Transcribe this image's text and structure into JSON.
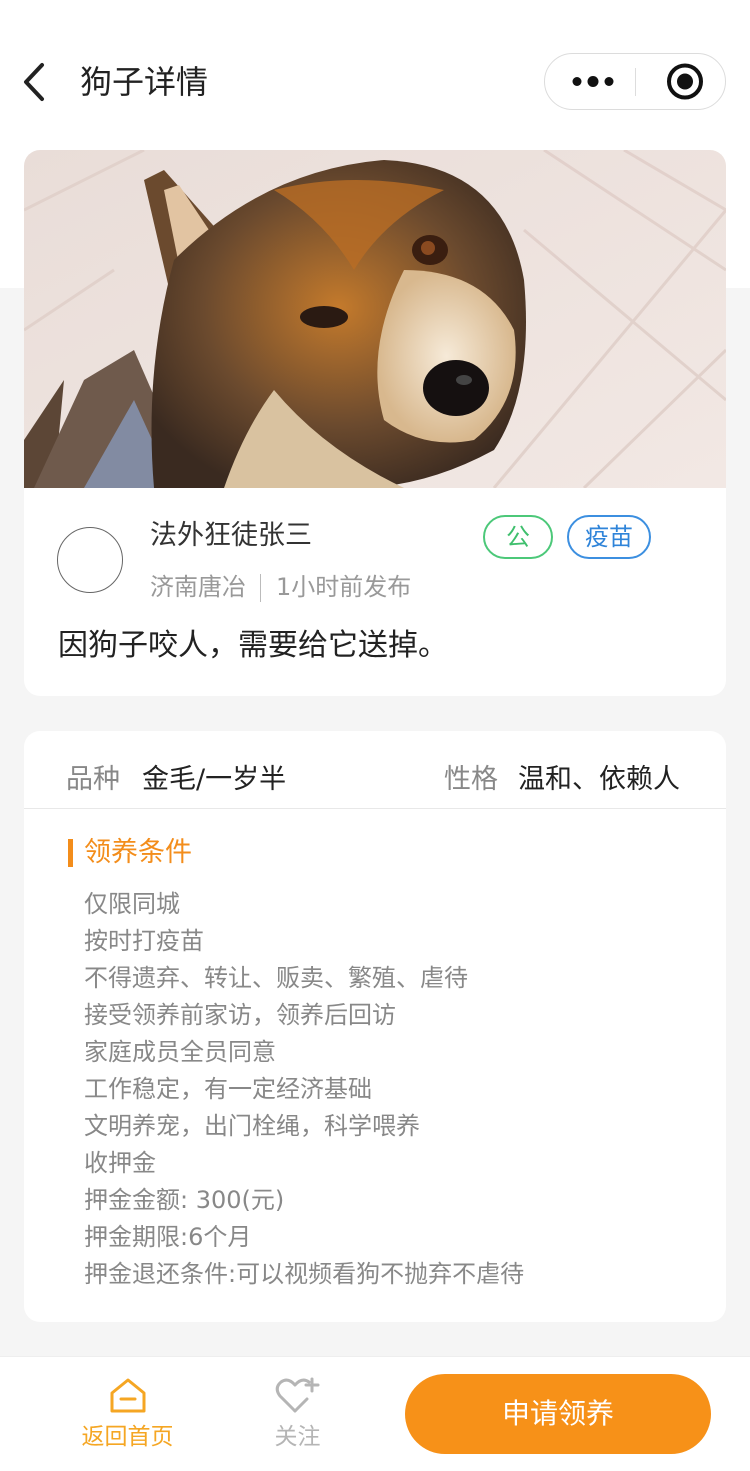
{
  "navbar": {
    "title": "狗子详情",
    "back_icon": "chevron-left-icon",
    "capsule_more_icon": "more-dots-icon",
    "capsule_close_icon": "record-icon"
  },
  "post": {
    "photo_alt": "dog photo",
    "username": "法外狂徒张三",
    "tags": [
      "公",
      "疫苗"
    ],
    "location": "济南唐冶",
    "post_time": "1小时前发布",
    "description": "因狗子咬人，需要给它送掉。"
  },
  "details": {
    "breed_label": "品种",
    "breed_value": "金毛/一岁半",
    "temper_label": "性格",
    "temper_value": "温和、依赖人",
    "conditions_title": "领养条件",
    "conditions": [
      "仅限同城",
      "按时打疫苗",
      "不得遗弃、转让、贩卖、繁殖、虐待",
      "接受领养前家访，领养后回访",
      "家庭成员全员同意",
      "工作稳定，有一定经济基础",
      "文明养宠，出门栓绳，科学喂养",
      "收押金",
      "押金金额: 300(元)",
      "押金期限:6个月",
      "押金退还条件:可以视频看狗不抛弃不虐待"
    ]
  },
  "bottom_bar": {
    "home_label": "返回首页",
    "home_icon": "home-icon",
    "follow_label": "关注",
    "follow_icon": "heart-plus-icon",
    "apply_label": "申请领养"
  },
  "colors": {
    "accent_orange": "#f79118",
    "home_yellow": "#f5a623",
    "tag_green": "#3fbf6d",
    "tag_blue": "#2f84d9"
  }
}
